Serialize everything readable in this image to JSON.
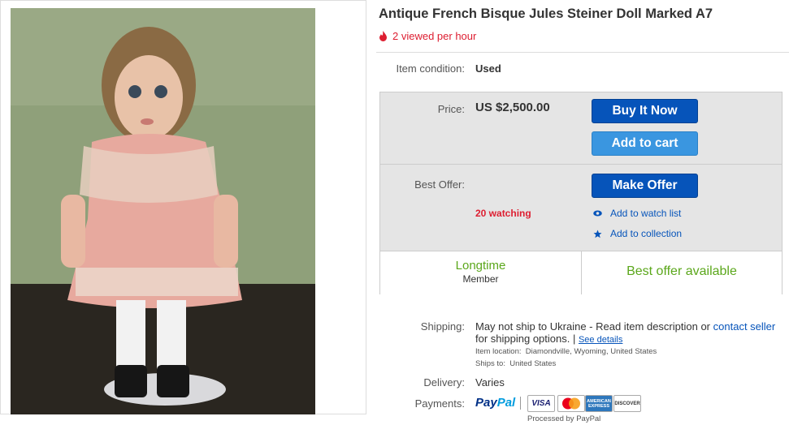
{
  "listing": {
    "title": "Antique French Bisque Jules Steiner Doll Marked A7",
    "viewed": "2 viewed per hour"
  },
  "condition": {
    "label": "Item condition:",
    "value": "Used"
  },
  "price": {
    "label": "Price:",
    "value": "US $2,500.00"
  },
  "buttons": {
    "buy_now": "Buy It Now",
    "add_cart": "Add to cart",
    "make_offer": "Make Offer"
  },
  "offer": {
    "label": "Best Offer:",
    "watching": "20 watching"
  },
  "links": {
    "watch_list": "Add to watch list",
    "collection": "Add to collection"
  },
  "seller": {
    "longtime": "Longtime",
    "member": "Member",
    "best_offer": "Best offer available"
  },
  "shipping": {
    "label": "Shipping:",
    "text_part1": "May not ship to Ukraine - Read item description or ",
    "contact_link": "contact seller",
    "text_part2": "for shipping options. | ",
    "see_details": "See details",
    "location_label": "Item location:",
    "location_value": "Diamondville, Wyoming, United States",
    "ships_label": "Ships to:",
    "ships_value": "United States"
  },
  "delivery": {
    "label": "Delivery:",
    "value": "Varies"
  },
  "payments": {
    "label": "Payments:",
    "paypal_part1": "Pay",
    "paypal_part2": "Pal",
    "cards": [
      "VISA",
      "MasterCard",
      "AMERICAN EXPRESS",
      "DISCOVER"
    ],
    "processed": "Processed by PayPal"
  },
  "colors": {
    "accent_blue": "#0654ba",
    "green": "#5ba71b",
    "red": "#dd1e31"
  }
}
